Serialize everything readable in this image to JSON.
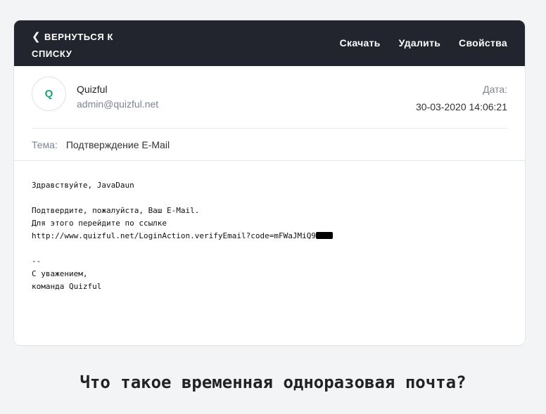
{
  "topbar": {
    "back_label": "ВЕРНУТЬСЯ К СПИСКУ",
    "back_icon": "chevron-left-icon",
    "actions": {
      "download": "Скачать",
      "delete": "Удалить",
      "properties": "Свойства"
    }
  },
  "sender": {
    "avatar_letter": "Q",
    "name": "Quizful",
    "email": "admin@quizful.net"
  },
  "date": {
    "label": "Дата:",
    "value": "30-03-2020 14:06:21"
  },
  "subject": {
    "label": "Тема:",
    "value": "Подтверждение E-Mail"
  },
  "message": {
    "greeting": "Здравствуйте, JavaDaun",
    "line1": "Подтвердите, пожалуйста, Ваш E-Mail.",
    "line2": "Для этого перейдите по ссылке",
    "link": "http://www.quizful.net/LoginAction.verifyEmail?code=mFWaJMiQ9",
    "sig_sep": "--",
    "sig1": "С уважением,",
    "sig2": "команда Quizful"
  },
  "heading": "Что такое временная одноразовая почта?",
  "colors": {
    "topbar": "#22252e",
    "avatar_accent": "#1aa37a",
    "page_bg": "#f3f4f6"
  }
}
